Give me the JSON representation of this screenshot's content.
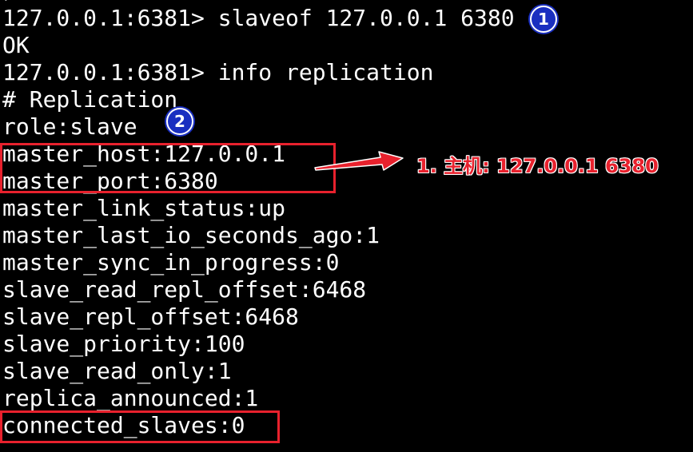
{
  "terminal": {
    "top_partial": ")",
    "lines": [
      "127.0.0.1:6381> slaveof 127.0.0.1 6380",
      "OK",
      "127.0.0.1:6381> info replication",
      "# Replication",
      "role:slave",
      "master_host:127.0.0.1",
      "master_port:6380",
      "master_link_status:up",
      "master_last_io_seconds_ago:1",
      "master_sync_in_progress:0",
      "slave_read_repl_offset:6468",
      "slave_repl_offset:6468",
      "slave_priority:100",
      "slave_read_only:1",
      "replica_announced:1",
      "connected_slaves:0"
    ]
  },
  "annotations": {
    "badge_1": "1",
    "badge_2": "2",
    "master_note": "1. 主机: 127.0.0.1 6380"
  },
  "colors": {
    "background": "#000000",
    "text": "#ffffff",
    "highlight": "#e8212d",
    "badge": "#1a2fc0"
  }
}
